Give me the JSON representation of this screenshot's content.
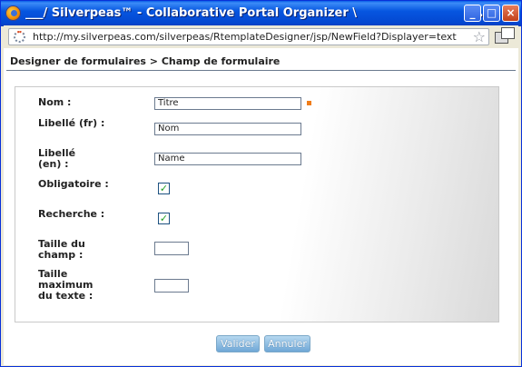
{
  "window": {
    "title": "___/ Silverpeas™ - Collaborative Portal Organizer \\",
    "title_suffix": "...",
    "minimize_label": "_",
    "maximize_label": "□",
    "close_label": "×"
  },
  "browser": {
    "url": "http://my.silverpeas.com/silverpeas/RtemplateDesigner/jsp/NewField?Displayer=text",
    "star_glyph": "☆"
  },
  "page": {
    "breadcrumb": "Designer de formulaires > Champ de formulaire"
  },
  "form": {
    "nom_label": "Nom :",
    "nom_value": "Titre",
    "libelle_fr_label": "Libellé (fr) :",
    "libelle_fr_value": "Nom",
    "libelle_en_label": "Libellé (en) :",
    "libelle_en_value": "Name",
    "obligatoire_label": "Obligatoire :",
    "obligatoire_checked": true,
    "recherche_label": "Recherche :",
    "recherche_checked": true,
    "taille_champ_label": "Taille du champ :",
    "taille_champ_value": "",
    "taille_max_label": "Taille maximum du texte :",
    "taille_max_value": "",
    "check_glyph": "✓"
  },
  "buttons": {
    "valider": "Valider",
    "annuler": "Annuler"
  },
  "colors": {
    "titlebar": "#0656e0",
    "required_marker": "#f07d1a",
    "button": "#6fa7d6",
    "checkmark": "#21a121"
  }
}
